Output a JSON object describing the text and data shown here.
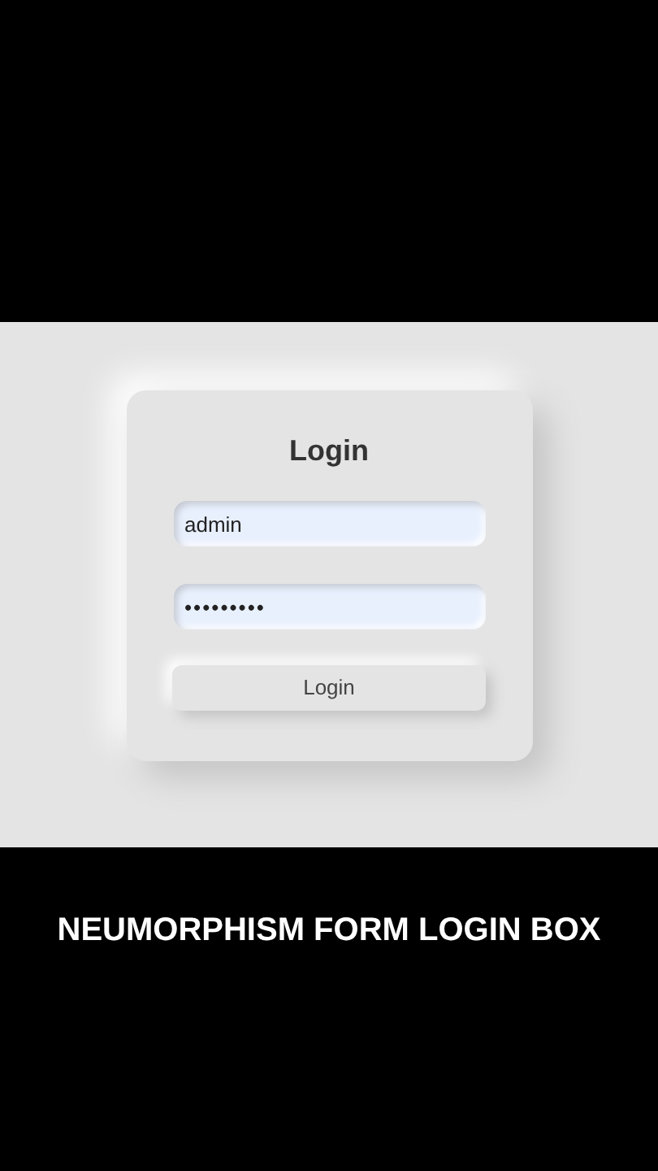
{
  "login_card": {
    "title": "Login",
    "fields": [
      {
        "kind": "text",
        "value": "admin"
      },
      {
        "kind": "password",
        "value": "•••••••••"
      }
    ],
    "button": "Login"
  },
  "caption": "NEUMORPHISM FORM LOGIN BOX"
}
